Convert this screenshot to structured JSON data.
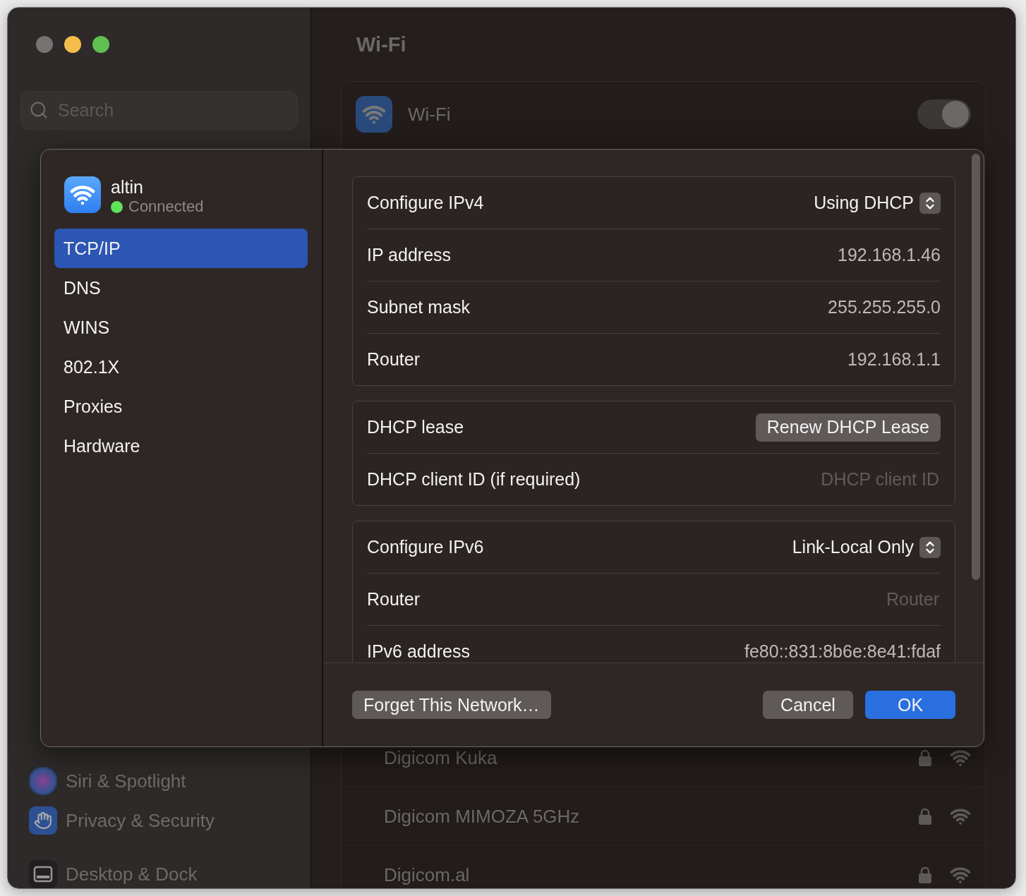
{
  "sidebar": {
    "search": {
      "placeholder": "Search"
    },
    "sections": [
      {
        "items": [
          {
            "label": "Siri & Spotlight",
            "kind": "siri"
          },
          {
            "label": "Privacy & Security",
            "kind": "privacy"
          }
        ]
      },
      {
        "items": [
          {
            "label": "Desktop & Dock",
            "kind": "dock"
          }
        ]
      }
    ]
  },
  "main": {
    "title": "Wi-Fi",
    "wifi": {
      "label": "Wi-Fi",
      "on": true
    },
    "networks": [
      {
        "name": "Digicom Kuka",
        "locked": true
      },
      {
        "name": "Digicom MIMOZA 5GHz",
        "locked": true
      },
      {
        "name": "Digicom.al",
        "locked": true
      }
    ]
  },
  "sheet": {
    "network": {
      "name": "altin",
      "status": "Connected"
    },
    "tabs": [
      {
        "label": "TCP/IP",
        "selected": true
      },
      {
        "label": "DNS",
        "selected": false
      },
      {
        "label": "WINS",
        "selected": false
      },
      {
        "label": "802.1X",
        "selected": false
      },
      {
        "label": "Proxies",
        "selected": false
      },
      {
        "label": "Hardware",
        "selected": false
      }
    ],
    "groups": [
      {
        "rows": [
          {
            "kind": "popup",
            "label": "Configure IPv4",
            "value": "Using DHCP"
          },
          {
            "kind": "value",
            "label": "IP address",
            "value": "192.168.1.46"
          },
          {
            "kind": "value",
            "label": "Subnet mask",
            "value": "255.255.255.0"
          },
          {
            "kind": "value",
            "label": "Router",
            "value": "192.168.1.1"
          }
        ]
      },
      {
        "rows": [
          {
            "kind": "button",
            "label": "DHCP lease",
            "value": "Renew DHCP Lease"
          },
          {
            "kind": "field",
            "label": "DHCP client ID (if required)",
            "placeholder": "DHCP client ID"
          }
        ]
      },
      {
        "rows": [
          {
            "kind": "popup",
            "label": "Configure IPv6",
            "value": "Link-Local Only"
          },
          {
            "kind": "field",
            "label": "Router",
            "placeholder": "Router"
          },
          {
            "kind": "value",
            "label": "IPv6 address",
            "value": "fe80::831:8b6e:8e41:fdaf"
          }
        ]
      }
    ],
    "buttons": {
      "forget": "Forget This Network…",
      "cancel": "Cancel",
      "ok": "OK"
    }
  }
}
